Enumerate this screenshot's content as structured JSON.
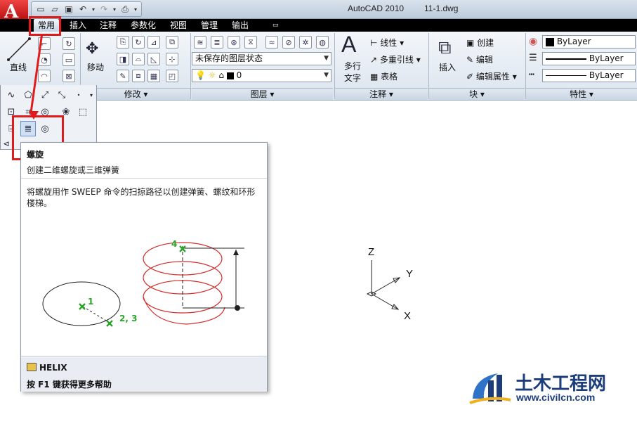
{
  "titlebar": {
    "app_title": "AutoCAD 2010",
    "file_title": "11-1.dwg"
  },
  "tabs": [
    {
      "label": "常用",
      "active": true
    },
    {
      "label": "插入"
    },
    {
      "label": "注释"
    },
    {
      "label": "参数化"
    },
    {
      "label": "视图"
    },
    {
      "label": "管理"
    },
    {
      "label": "输出"
    }
  ],
  "ribbon": {
    "draw": {
      "line_label": "直线"
    },
    "modify": {
      "move_label": "移动",
      "panel_title": "修改 ▾"
    },
    "layers": {
      "layer_state": "未保存的图层状态",
      "current_layer": "0",
      "panel_title": "图层 ▾"
    },
    "annotation": {
      "mtext_label_1": "多行",
      "mtext_label_2": "文字",
      "linear_label": "线性",
      "mleader_label": "多重引线",
      "table_label": "表格",
      "panel_title": "注释 ▾"
    },
    "block": {
      "insert_label": "插入",
      "create_label": "创建",
      "edit_label": "编辑",
      "edit_attr_label": "编辑属性",
      "panel_title": "块 ▾"
    },
    "properties": {
      "color": "ByLayer",
      "linetype": "ByLayer",
      "lineweight": "ByLayer",
      "panel_title": "特性 ▾"
    }
  },
  "tooltip": {
    "title": "螺旋",
    "subtitle": "创建二维螺旋或三维弹簧",
    "description": "将螺旋用作 SWEEP 命令的扫掠路径以创建弹簧、螺纹和环形楼梯。",
    "diagram_labels": {
      "p1": "1",
      "p23": "2, 3",
      "p4": "4"
    },
    "command": "HELIX",
    "help": "按 F1 键获得更多帮助"
  },
  "ucs": {
    "x": "X",
    "y": "Y",
    "z": "Z"
  },
  "watermark": {
    "name": "土木工程网",
    "url": "www.civilcn.com"
  },
  "colors": {
    "highlight": "#e01b1b",
    "helix": "#d42a2a",
    "points": "#2aa52a"
  }
}
